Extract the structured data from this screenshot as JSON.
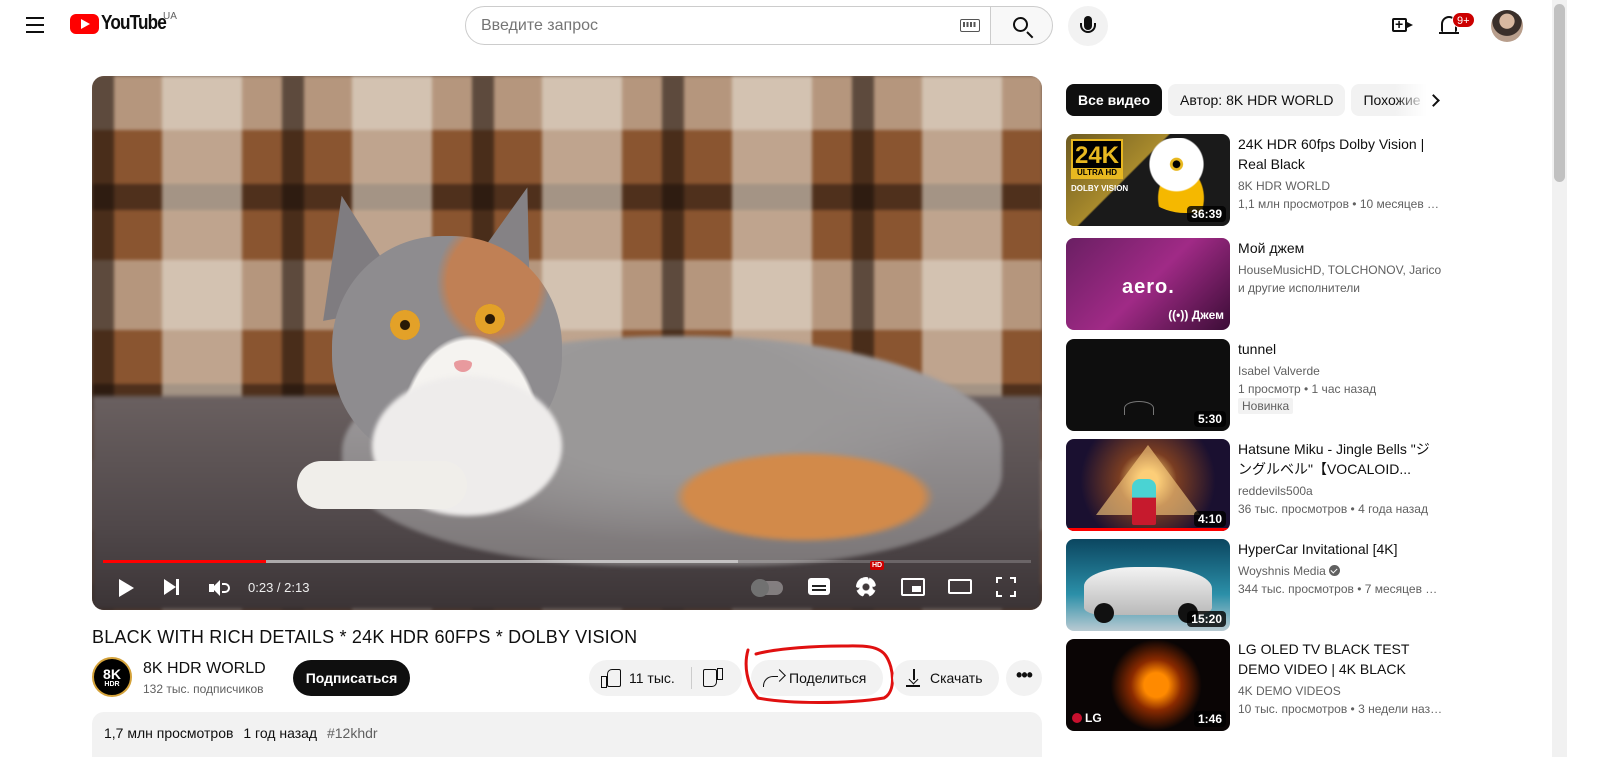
{
  "header": {
    "logo_text": "YouTube",
    "country": "UA",
    "search_placeholder": "Введите запрос",
    "notifications_badge": "9+"
  },
  "player": {
    "current_time": "0:23",
    "duration": "2:13",
    "time_display": "0:23 / 2:13",
    "progress_fraction": 0.176,
    "buffer_fraction": 0.684,
    "settings_badge": "HD"
  },
  "video": {
    "title": "BLACK WITH RICH DETAILS * 24K HDR 60FPS * DOLBY VISION",
    "channel": {
      "avatar_text_big": "8K",
      "avatar_text_small": "HDR",
      "name": "8K HDR WORLD",
      "subscribers": "132 тыс. подписчиков"
    },
    "subscribe_label": "Подписаться",
    "likes": "11 тыс.",
    "share_label": "Поделиться",
    "download_label": "Скачать",
    "more_label": "•••",
    "description": {
      "views": "1,7 млн просмотров",
      "date": "1 год назад",
      "tag": "#12khdr"
    }
  },
  "chips": [
    {
      "label": "Все видео",
      "active": true
    },
    {
      "label": "Автор: 8K HDR WORLD",
      "active": false
    },
    {
      "label": "Похожие",
      "active": false
    }
  ],
  "recommendations": [
    {
      "title": "24K HDR 60fps Dolby Vision | Real Black",
      "channel": "8K HDR WORLD",
      "meta": "1,1 млн просмотров • 10 месяцев назад",
      "duration": "36:39",
      "thumb_text": {
        "big": "24K",
        "uhd": "ULTRA HD",
        "dolby": "DOLBY VISION"
      }
    },
    {
      "title": "Мой джем",
      "channel": "HouseMusicHD, TOLCHONOV, Jarico",
      "meta": "и другие исполнители",
      "badge": "((•)) Джем",
      "thumb_text": {
        "brand": "aero."
      }
    },
    {
      "title": "tunnel",
      "channel": "Isabel Valverde",
      "meta": "1 просмотр • 1 час назад",
      "new_badge": "Новинка",
      "duration": "5:30"
    },
    {
      "title": "Hatsune Miku - Jingle Bells \"ジングルベル\"【VOCALOID...",
      "channel": "reddevils500a",
      "meta": "36 тыс. просмотров • 4 года назад",
      "duration": "4:10",
      "watched_fraction": 1.0
    },
    {
      "title": "HyperCar Invitational [4K]",
      "channel": "Woyshnis Media",
      "verified": true,
      "meta": "344 тыс. просмотров • 7 месяцев назад",
      "duration": "15:20"
    },
    {
      "title": "LG OLED TV BLACK TEST DEMO VIDEO | 4K BLACK TEST...",
      "channel": "4K DEMO VIDEOS",
      "meta": "10 тыс. просмотров • 3 недели назад",
      "duration": "1:46",
      "thumb_text": {
        "brand": "LG"
      }
    }
  ],
  "colors": {
    "brand_red": "#ff0000",
    "progress_red": "#ff0000",
    "annotation_red": "#e01010",
    "chip_active_bg": "#0f0f0f",
    "button_bg": "#f2f2f2"
  }
}
